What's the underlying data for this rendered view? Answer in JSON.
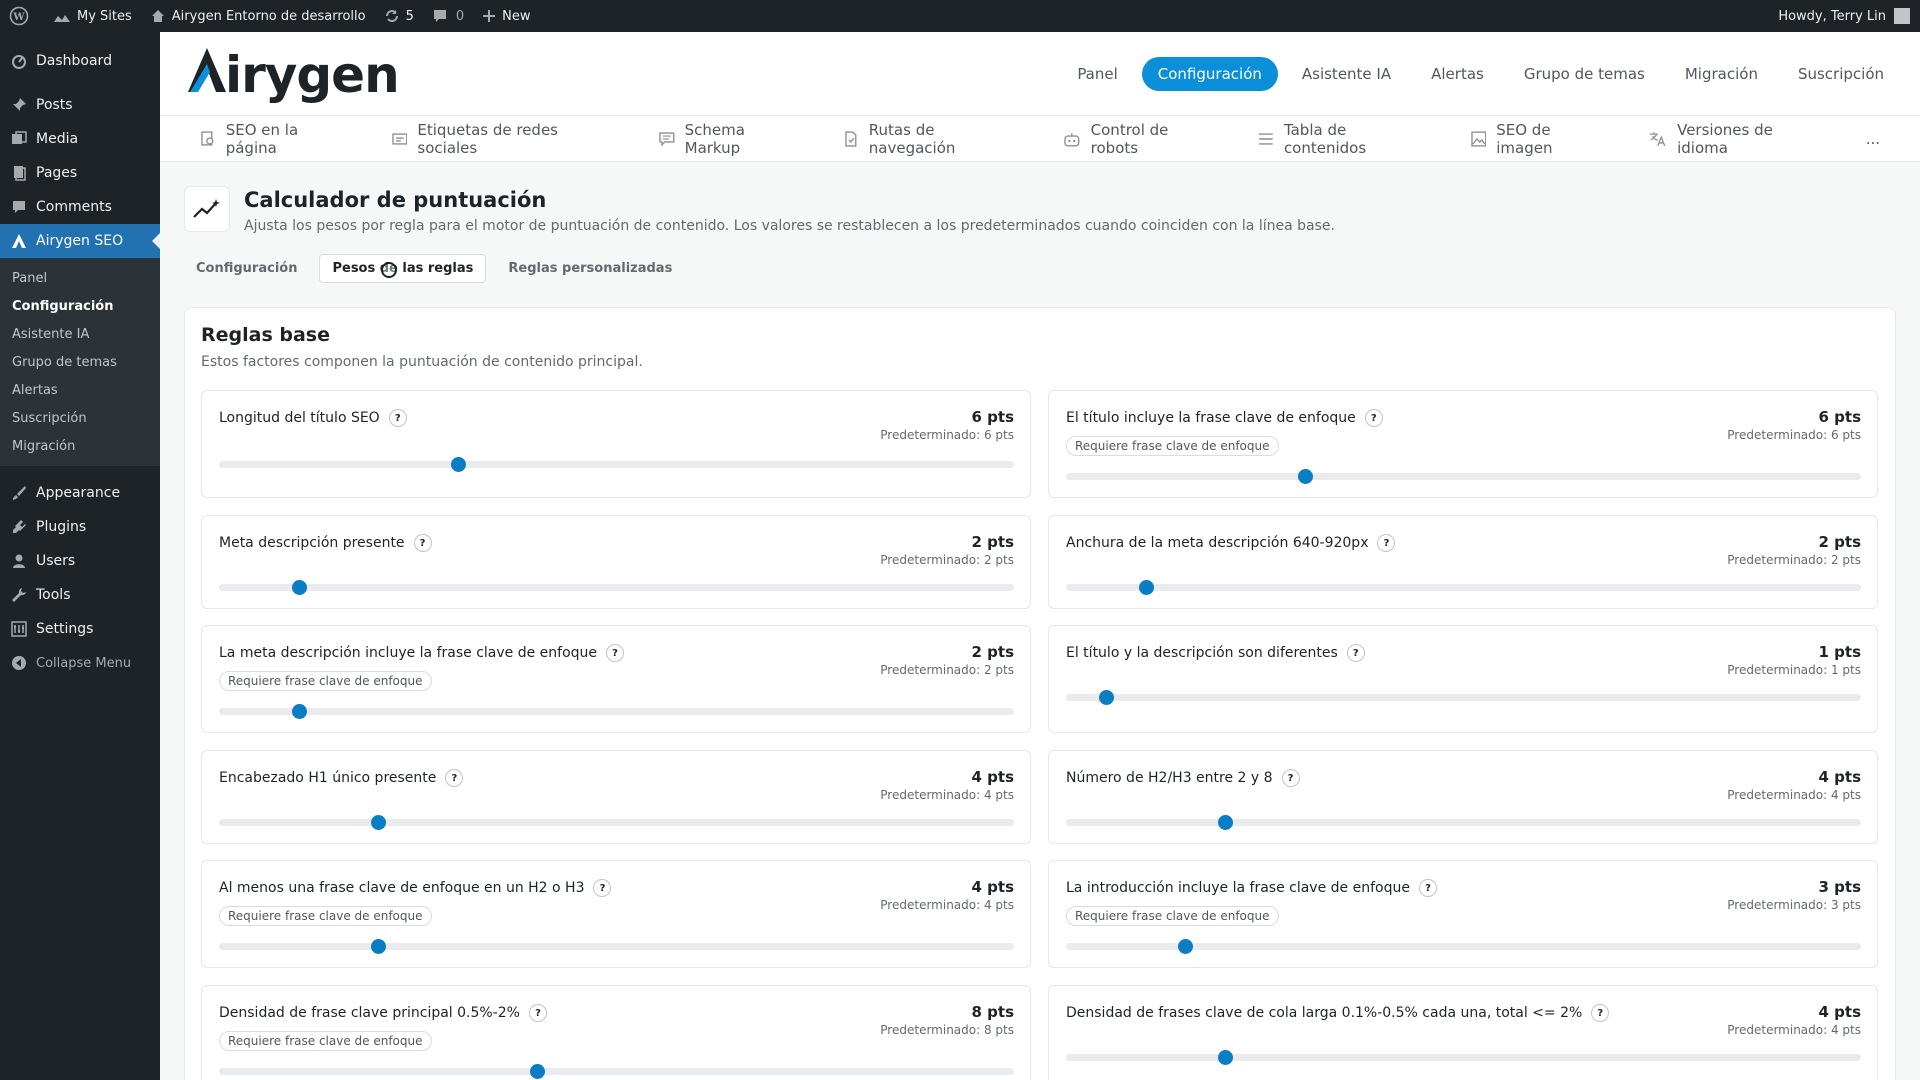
{
  "adminbar": {
    "my_sites": "My Sites",
    "site_name": "Airygen Entorno de desarrollo",
    "updates_count": "5",
    "comments_count": "0",
    "new_label": "New",
    "howdy": "Howdy, Terry Lin"
  },
  "sidebar": {
    "dashboard": "Dashboard",
    "posts": "Posts",
    "media": "Media",
    "pages": "Pages",
    "comments": "Comments",
    "airygen": "Airygen SEO",
    "sub": [
      "Panel",
      "Configuración",
      "Asistente IA",
      "Grupo de temas",
      "Alertas",
      "Suscripción",
      "Migración"
    ],
    "appearance": "Appearance",
    "plugins": "Plugins",
    "users": "Users",
    "tools": "Tools",
    "settings": "Settings",
    "collapse": "Collapse Menu"
  },
  "logo": {
    "text_a": "A",
    "text_rest": "irygen"
  },
  "topnav": [
    "Panel",
    "Configuración",
    "Asistente IA",
    "Alertas",
    "Grupo de temas",
    "Migración",
    "Suscripción"
  ],
  "subnav": [
    "SEO en la página",
    "Etiquetas de redes sociales",
    "Schema Markup",
    "Rutas de navegación",
    "Control de robots",
    "Tabla de contenidos",
    "SEO de imagen",
    "Versiones de idioma",
    "..."
  ],
  "header": {
    "title": "Calculador de puntuación",
    "desc": "Ajusta los pesos por regla para el motor de puntuación de contenido. Los valores se restablecen a los predeterminados cuando coinciden con la línea base."
  },
  "pilltabs": [
    "Configuración",
    "Pesos de las reglas",
    "Reglas personalizadas"
  ],
  "panel": {
    "title": "Reglas base",
    "desc": "Estos factores componen la puntuación de contenido principal."
  },
  "rules": [
    {
      "title": "Longitud del título SEO",
      "pts": "6 pts",
      "def": "Predeterminado: 6 pts",
      "req": "",
      "level": 0.3
    },
    {
      "title": "El título incluye la frase clave de enfoque",
      "pts": "6 pts",
      "def": "Predeterminado: 6 pts",
      "req": "Requiere frase clave de enfoque",
      "level": 0.3
    },
    {
      "title": "Meta descripción presente",
      "pts": "2 pts",
      "def": "Predeterminado: 2 pts",
      "req": "",
      "level": 0.1
    },
    {
      "title": "Anchura de la meta descripción 640-920px",
      "pts": "2 pts",
      "def": "Predeterminado: 2 pts",
      "req": "",
      "level": 0.1
    },
    {
      "title": "La meta descripción incluye la frase clave de enfoque",
      "pts": "2 pts",
      "def": "Predeterminado: 2 pts",
      "req": "Requiere frase clave de enfoque",
      "level": 0.1
    },
    {
      "title": "El título y la descripción son diferentes",
      "pts": "1 pts",
      "def": "Predeterminado: 1 pts",
      "req": "",
      "level": 0.05
    },
    {
      "title": "Encabezado H1 único presente",
      "pts": "4 pts",
      "def": "Predeterminado: 4 pts",
      "req": "",
      "level": 0.2
    },
    {
      "title": "Número de H2/H3 entre 2 y 8",
      "pts": "4 pts",
      "def": "Predeterminado: 4 pts",
      "req": "",
      "level": 0.2
    },
    {
      "title": "Al menos una frase clave de enfoque en un H2 o H3",
      "pts": "4 pts",
      "def": "Predeterminado: 4 pts",
      "req": "Requiere frase clave de enfoque",
      "level": 0.2
    },
    {
      "title": "La introducción incluye la frase clave de enfoque",
      "pts": "3 pts",
      "def": "Predeterminado: 3 pts",
      "req": "Requiere frase clave de enfoque",
      "level": 0.15
    },
    {
      "title": "Densidad de frase clave principal 0.5%-2%",
      "pts": "8 pts",
      "def": "Predeterminado: 8 pts",
      "req": "Requiere frase clave de enfoque",
      "level": 0.4
    },
    {
      "title": "Densidad de frases clave de cola larga 0.1%-0.5% cada una, total <= 2%",
      "pts": "4 pts",
      "def": "Predeterminado: 4 pts",
      "req": "",
      "level": 0.2
    }
  ],
  "colors": {
    "accent": "#0a8fd8",
    "admin_dark": "#1d2327",
    "active_menu": "#2271b1"
  }
}
